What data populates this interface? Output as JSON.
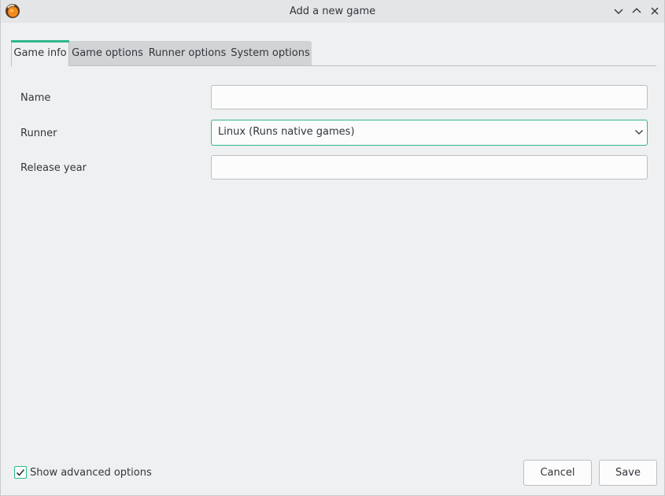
{
  "window": {
    "title": "Add a new game"
  },
  "tabs": [
    {
      "label": "Game info",
      "active": true
    },
    {
      "label": "Game options",
      "active": false
    },
    {
      "label": "Runner options",
      "active": false
    },
    {
      "label": "System options",
      "active": false
    }
  ],
  "form": {
    "name": {
      "label": "Name",
      "value": "",
      "placeholder": ""
    },
    "runner": {
      "label": "Runner",
      "selected": "Linux (Runs native games)"
    },
    "release_year": {
      "label": "Release year",
      "value": "",
      "placeholder": ""
    }
  },
  "footer": {
    "show_advanced_label": "Show advanced options",
    "show_advanced_checked": true,
    "cancel_label": "Cancel",
    "save_label": "Save"
  },
  "colors": {
    "accent": "#2eb88a",
    "window_bg": "#eff0f1",
    "app_icon": "#f28a1a"
  },
  "icons": {
    "app": "lutris-icon",
    "minimize": "chevron-down-icon",
    "maximize": "chevron-up-icon",
    "close": "close-icon",
    "dropdown": "chevron-down-icon",
    "check": "check-icon"
  }
}
